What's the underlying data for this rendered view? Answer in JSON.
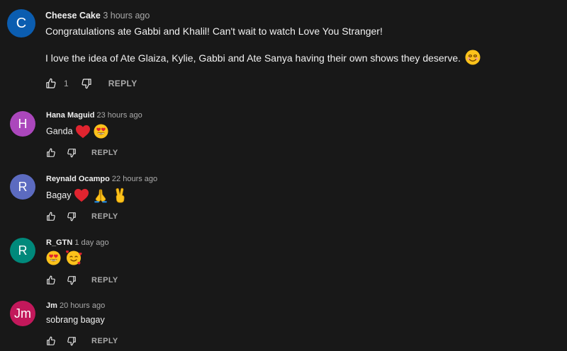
{
  "colors": {
    "background": "#181818",
    "text_primary": "#f1f1f1",
    "text_secondary": "#aaaaaa"
  },
  "comments": [
    {
      "author": "Cheese Cake",
      "time": "3 hours ago",
      "avatar_letter": "C",
      "avatar_color": "#0b5db0",
      "lines": [
        "Congratulations ate Gabbi and Khalil! Can't wait to watch Love You Stranger!",
        "I love the idea of Ate Glaiza, Kylie, Gabbi and Ate Sanya  having their own shows they deserve."
      ],
      "emojis": [
        "smiling-face-emoji"
      ],
      "likes": "1",
      "reply_label": "REPLY"
    },
    {
      "author": "Hana Maguid",
      "time": "23 hours ago",
      "avatar_letter": "H",
      "avatar_color": "#ab47bc",
      "text": "Ganda",
      "emojis": [
        "red-heart-emoji",
        "heart-eyes-emoji"
      ],
      "reply_label": "REPLY"
    },
    {
      "author": "Reynald Ocampo",
      "time": "22 hours ago",
      "avatar_letter": "R",
      "avatar_color": "#5c6bc0",
      "text": "Bagay",
      "emojis": [
        "red-heart-emoji",
        "folded-hands-emoji",
        "victory-hand-emoji"
      ],
      "reply_label": "REPLY"
    },
    {
      "author": "R_GTN",
      "time": "1 day ago",
      "avatar_letter": "R",
      "avatar_color": "#00897b",
      "text": "",
      "emojis": [
        "heart-eyes-emoji",
        "smiling-face-with-hearts-emoji"
      ],
      "reply_label": "REPLY"
    },
    {
      "author": "Jm",
      "time": "20 hours ago",
      "avatar_letter": "Jm",
      "avatar_color": "#c2185b",
      "text": "sobrang bagay",
      "emojis": [],
      "reply_label": "REPLY"
    }
  ]
}
